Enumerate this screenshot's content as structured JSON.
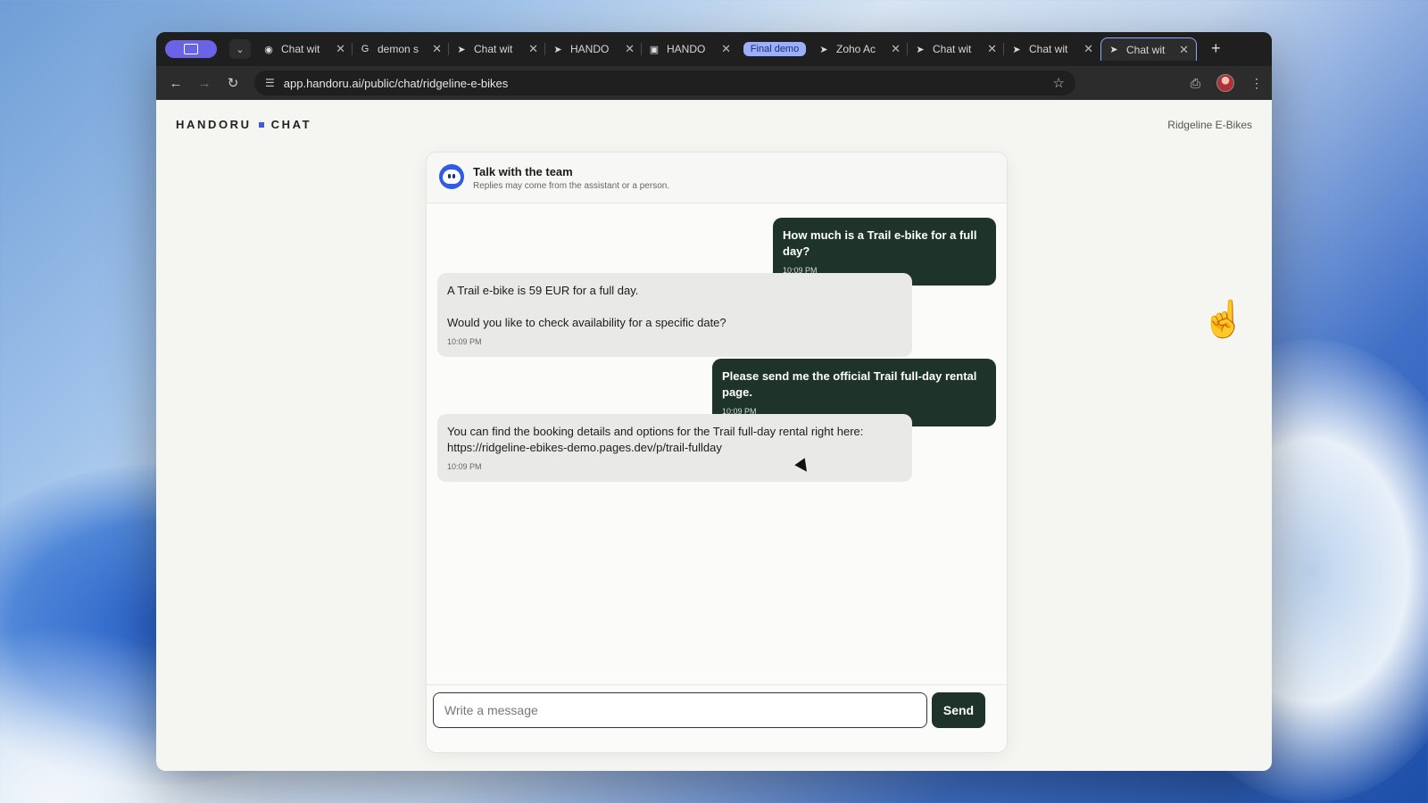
{
  "browser": {
    "tabs": [
      {
        "title": "Chat wit",
        "favicon": "bot-favicon"
      },
      {
        "title": "demon s",
        "favicon": "google-favicon"
      },
      {
        "title": "Chat wit",
        "favicon": "pointer-favicon"
      },
      {
        "title": "HANDO",
        "favicon": "pointer-favicon"
      },
      {
        "title": "HANDO",
        "favicon": "handoru-favicon"
      },
      {
        "title": "Final demo",
        "favicon": "bike-favicon",
        "group": true
      },
      {
        "title": "Zoho Ac",
        "favicon": "pointer-favicon"
      },
      {
        "title": "Chat wit",
        "favicon": "pointer-favicon"
      },
      {
        "title": "Chat wit",
        "favicon": "pointer-favicon"
      },
      {
        "title": "Chat wit",
        "favicon": "pointer-favicon",
        "active": true
      }
    ],
    "url": "app.handoru.ai/public/chat/ridgeline-e-bikes",
    "accent": "#8ea8ff"
  },
  "page": {
    "brand_left": "HANDORU",
    "brand_right": "CHAT",
    "company": "Ridgeline E-Bikes"
  },
  "chat": {
    "title": "Talk with the team",
    "subtitle": "Replies may come from the assistant or a person.",
    "messages": [
      {
        "role": "user",
        "text": "How much is a Trail e-bike for a full day?",
        "time": "10:09 PM"
      },
      {
        "role": "bot",
        "text": "A Trail e-bike is 59 EUR for a full day.\n\nWould you like to check availability for a specific date?",
        "time": "10:09 PM"
      },
      {
        "role": "user",
        "text": "Please send me the official Trail full-day rental page.",
        "time": "10:09 PM"
      },
      {
        "role": "bot",
        "text": "You can find the booking details and options for the Trail full-day rental right here:\nhttps://ridgeline-ebikes-demo.pages.dev/p/trail-fullday",
        "time": "10:09 PM"
      }
    ],
    "input_placeholder": "Write a message",
    "input_value": "",
    "send_label": "Send",
    "colors": {
      "user_bubble": "#1e3329",
      "bot_bubble": "#e9eae7",
      "brand_dot": "#3d5be0"
    }
  }
}
